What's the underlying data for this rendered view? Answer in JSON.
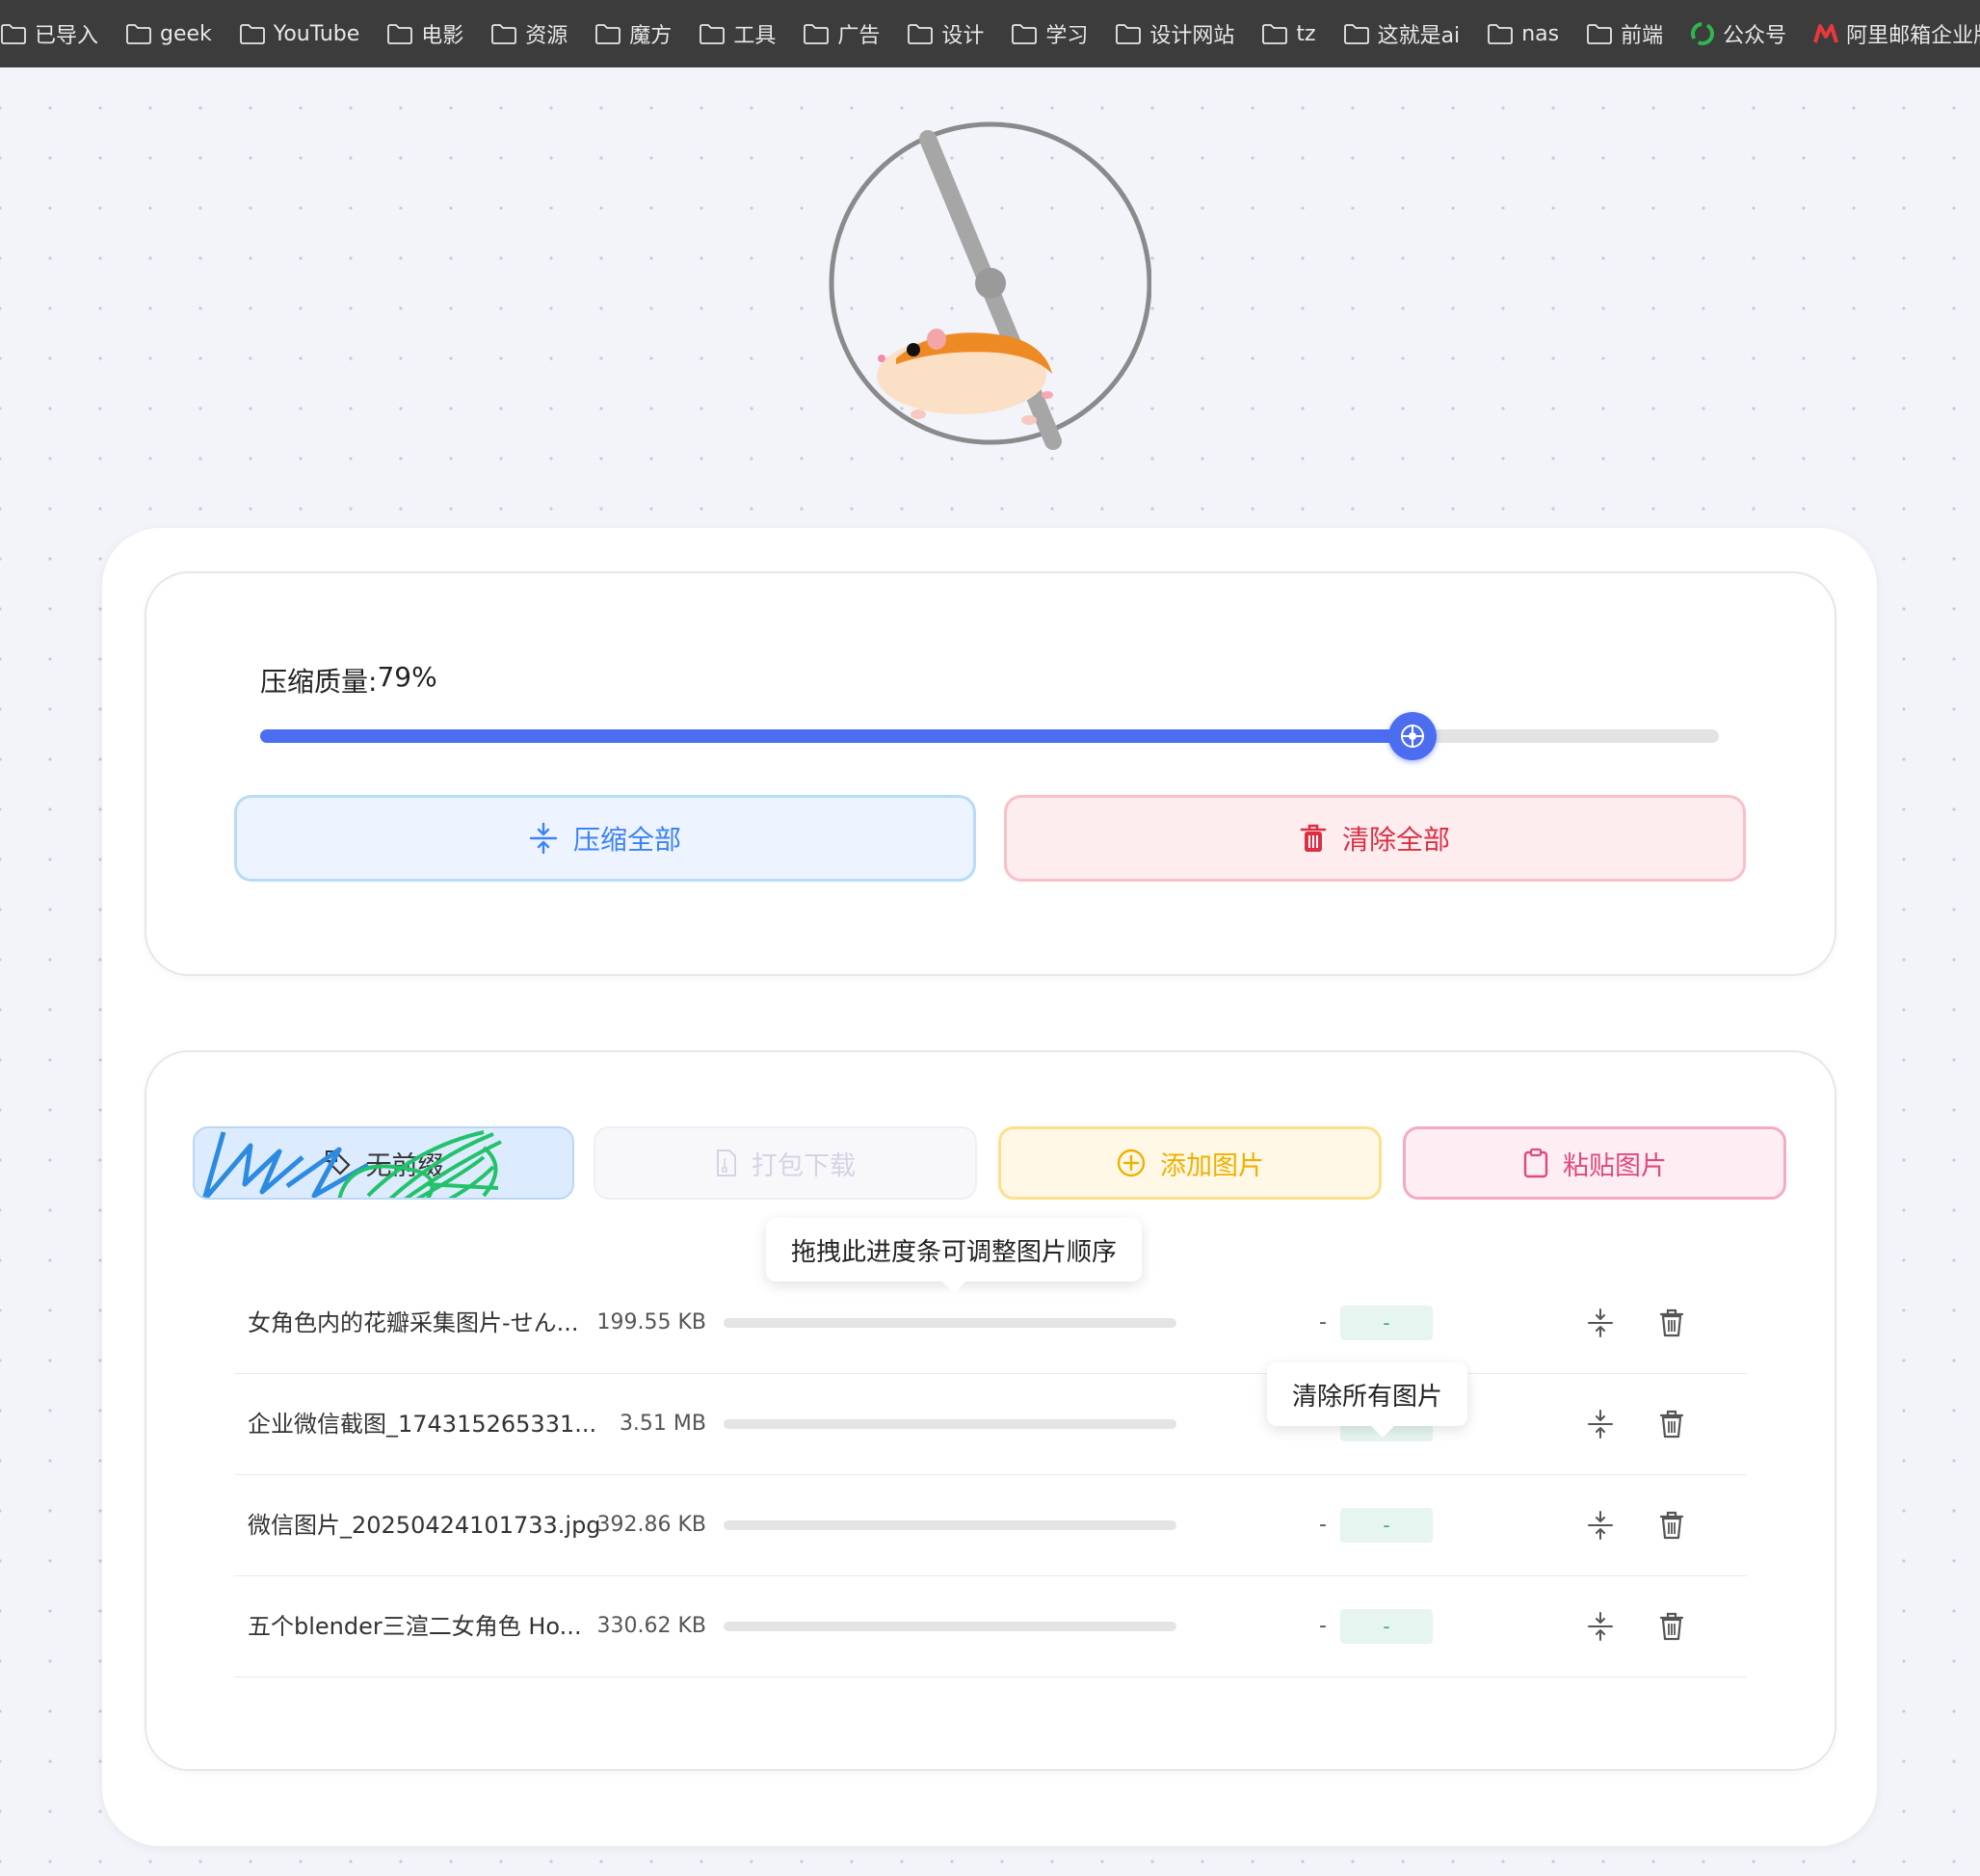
{
  "bookmarks": [
    {
      "label": "已导入",
      "icon": "folder-icon"
    },
    {
      "label": "geek",
      "icon": "folder-icon"
    },
    {
      "label": "YouTube",
      "icon": "folder-icon"
    },
    {
      "label": "电影",
      "icon": "folder-icon"
    },
    {
      "label": "资源",
      "icon": "folder-icon"
    },
    {
      "label": "魔方",
      "icon": "folder-icon"
    },
    {
      "label": "工具",
      "icon": "folder-icon"
    },
    {
      "label": "广告",
      "icon": "folder-icon"
    },
    {
      "label": "设计",
      "icon": "folder-icon"
    },
    {
      "label": "学习",
      "icon": "folder-icon"
    },
    {
      "label": "设计网站",
      "icon": "folder-icon"
    },
    {
      "label": "tz",
      "icon": "folder-icon"
    },
    {
      "label": "这就是ai",
      "icon": "folder-icon"
    },
    {
      "label": "nas",
      "icon": "folder-icon"
    },
    {
      "label": "前端",
      "icon": "folder-icon"
    },
    {
      "label": "公众号",
      "icon": "wechat-official-icon"
    },
    {
      "label": "阿里邮箱企业版",
      "icon": "aliyun-mail-icon"
    }
  ],
  "settings": {
    "quality_label": "压缩质量: ",
    "quality_value": "79%",
    "quality": 0.79,
    "compress_all_label": "压缩全部",
    "clear_all_label": "清除全部"
  },
  "actions": {
    "prefix_label": "无前缀",
    "download_label": "打包下载",
    "add_label": "添加图片",
    "paste_label": "粘贴图片"
  },
  "tooltips": {
    "drag_hint": "拖拽此进度条可调整图片顺序",
    "clear_hint": "清除所有图片"
  },
  "files": [
    {
      "name": "女角色内的花瓣采集图片-せん...",
      "size": "199.55 KB",
      "dash": "-",
      "badge": "-"
    },
    {
      "name": "企业微信截图_174315265331...",
      "size": "3.51 MB",
      "dash": "-",
      "badge": "-"
    },
    {
      "name": "微信图片_20250424101733.jpg",
      "size": "392.86 KB",
      "dash": "-",
      "badge": "-"
    },
    {
      "name": "五个blender三渲二女角色 Ho...",
      "size": "330.62 KB",
      "dash": "-",
      "badge": "-"
    }
  ],
  "colors": {
    "accent": "#4d6df0",
    "compress_blue": "#3b82f6",
    "danger_red": "#dc2f44",
    "add_yellow": "#f0b000",
    "paste_pink": "#e2487e"
  }
}
